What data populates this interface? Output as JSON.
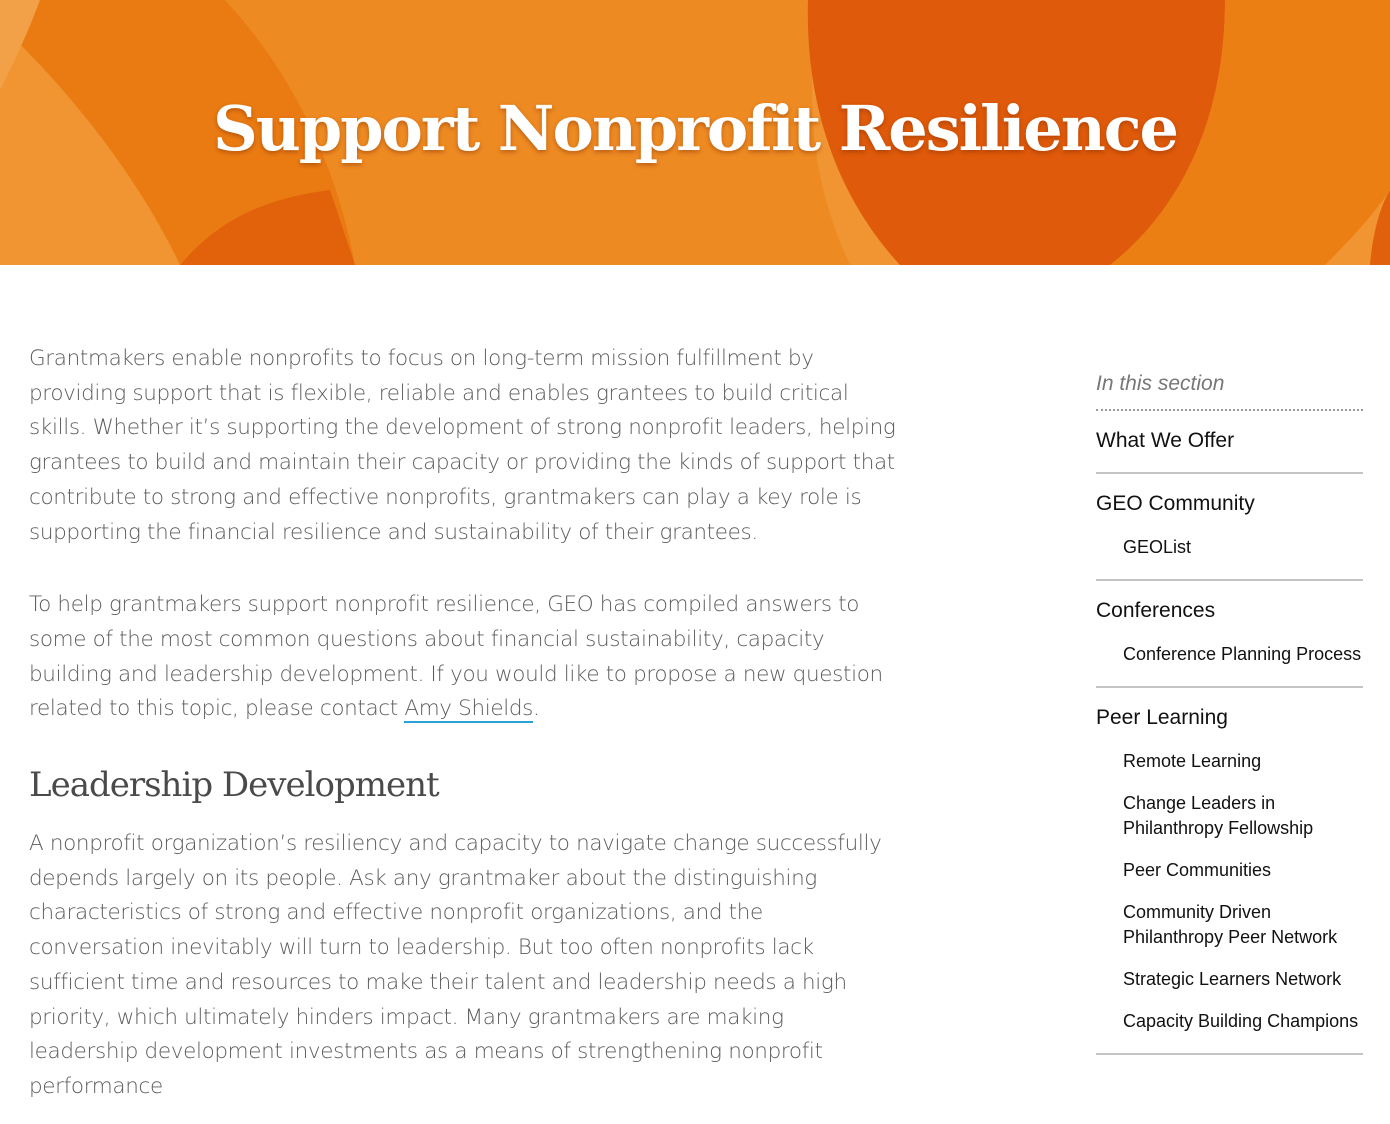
{
  "hero": {
    "title": "Support Nonprofit Resilience"
  },
  "main": {
    "intro_paragraph": "Grantmakers enable nonprofits to focus on long-term mission fulfillment by providing support that is flexible, reliable and enables grantees to build critical skills. Whether it’s supporting the development of strong nonprofit leaders, helping grantees to build and maintain their capacity or providing the kinds of support that contribute to strong and effective nonprofits, grantmakers can play a key role is supporting the financial resilience and sustainability of their grantees.",
    "help_paragraph_before_link": "To help grantmakers support nonprofit resilience, GEO has compiled answers to some of the most common questions about financial sustainability, capacity building and leadership development. If you would like to propose a new question related to this topic, please contact ",
    "contact_link": "Amy Shields",
    "help_paragraph_after_link": ".",
    "section_heading": "Leadership Development",
    "section_paragraph": "A nonprofit organization’s resiliency and capacity to navigate change successfully depends largely on its people. Ask any grantmaker about the distinguishing characteristics of strong and effective nonprofit organizations, and the conversation inevitably will turn to leadership. But too often nonprofits lack sufficient time and resources to make their talent and leadership needs a high priority, which ultimately hinders impact. Many grantmakers are making leadership development investments as a means of strengthening nonprofit performance"
  },
  "sidebar": {
    "header": "In this section",
    "groups": [
      {
        "label": "What We Offer",
        "items": []
      },
      {
        "label": "GEO Community",
        "items": [
          "GEOList"
        ]
      },
      {
        "label": "Conferences",
        "items": [
          "Conference Planning Process"
        ]
      },
      {
        "label": "Peer Learning",
        "items": [
          "Remote Learning",
          "Change Leaders in Philanthropy Fellowship",
          "Peer Communities",
          "Community Driven Philanthropy Peer Network",
          "Strategic Learners Network",
          "Capacity Building Champions"
        ]
      }
    ]
  },
  "colors": {
    "hero_base": "#f09531",
    "hero_mid": "#ea7b12",
    "hero_dark": "#df5a0a",
    "link_underline": "#2aa2d4"
  }
}
